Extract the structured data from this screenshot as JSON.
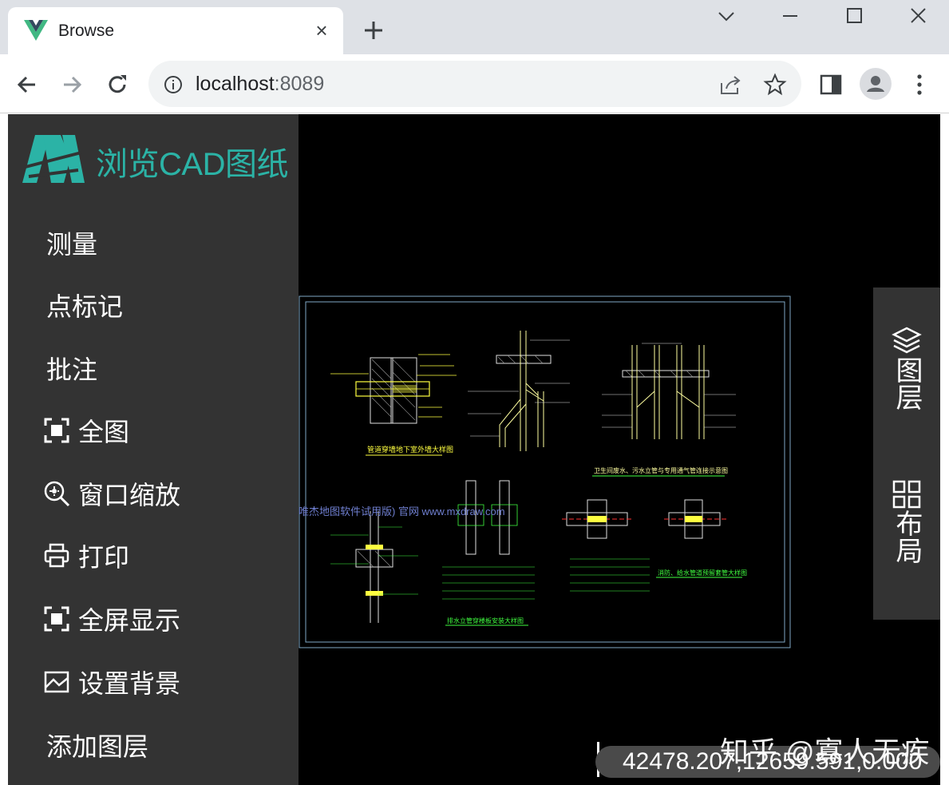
{
  "browser": {
    "tab_title": "Browse",
    "tab_close": "×",
    "url_host": "localhost",
    "url_port": ":8089"
  },
  "sidebar": {
    "brand": "浏览CAD图纸",
    "items": [
      {
        "label": "测量",
        "icon": ""
      },
      {
        "label": "点标记",
        "icon": ""
      },
      {
        "label": "批注",
        "icon": ""
      },
      {
        "label": "全图",
        "icon": "fullview-icon"
      },
      {
        "label": "窗口缩放",
        "icon": "window-zoom-icon"
      },
      {
        "label": "打印",
        "icon": "print-icon"
      },
      {
        "label": "全屏显示",
        "icon": "fullscreen-icon"
      },
      {
        "label": "设置背景",
        "icon": "background-icon"
      },
      {
        "label": "添加图层",
        "icon": ""
      }
    ]
  },
  "right_panel": {
    "layers_label": "图层",
    "layout_label": "布局"
  },
  "canvas": {
    "watermark": "唯杰地图软件试用版) 官网 www.mxdraw.com",
    "drawing_labels": {
      "t1": "管道穿墙地下室外墙大样图",
      "t2": "卫生间废水、污水立管与专用通气管连接示意图",
      "t3": "排水立管穿楼板安装大样图",
      "t4": "消防、给水管道预留套管大样图"
    },
    "coordinates": "42478.207,12659.591,0.000",
    "overlay_watermark": "知乎 @寡人无疾"
  },
  "colors": {
    "sidebar_bg": "#333333",
    "brand": "#2bb3a6",
    "canvas_bg": "#000000"
  }
}
